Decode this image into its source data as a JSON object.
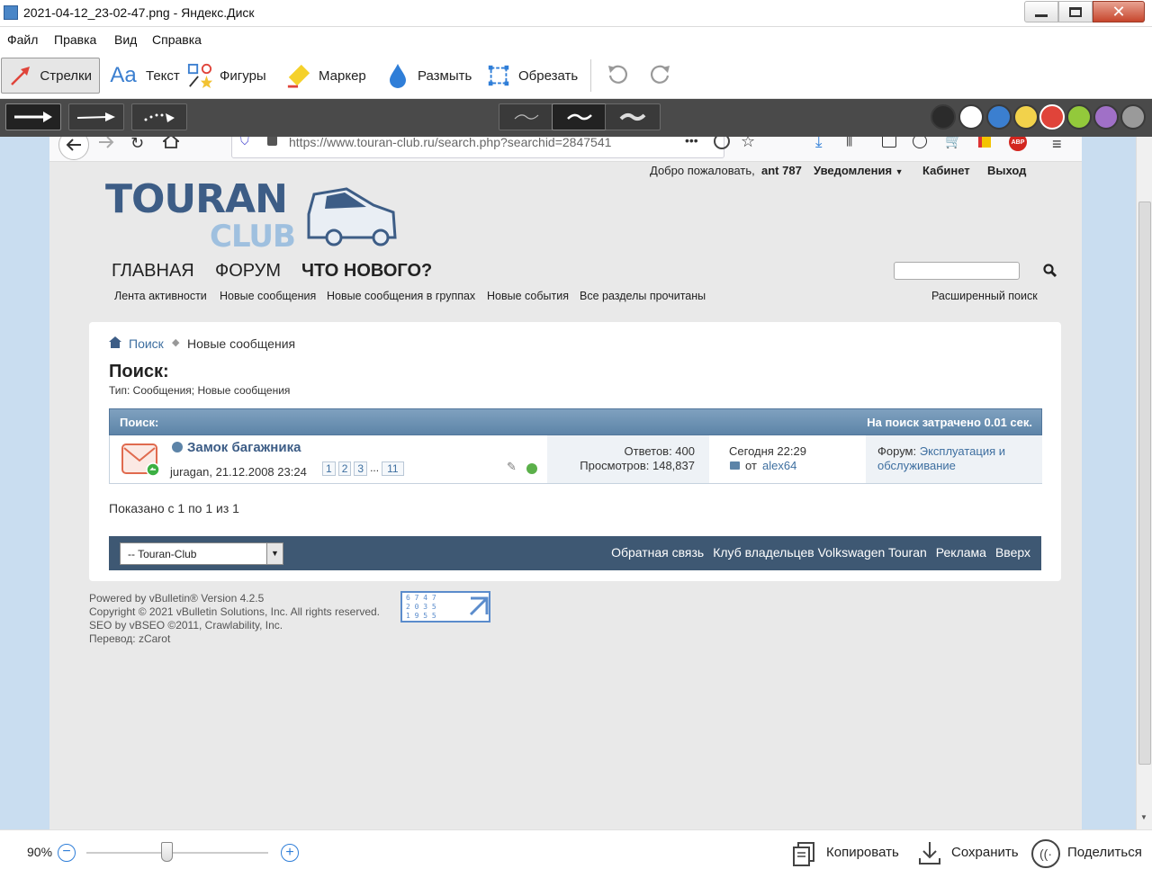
{
  "window": {
    "title": "2021-04-12_23-02-47.png - Яндекс.Диск",
    "close_glyph": "✕"
  },
  "menu": [
    "Файл",
    "Правка",
    "Вид",
    "Справка"
  ],
  "tools": [
    "Стрелки",
    "Текст",
    "Фигуры",
    "Маркер",
    "Размыть",
    "Обрезать"
  ],
  "palette": [
    "#2b2b2b",
    "#ffffff",
    "#3b7fd0",
    "#f2d24b",
    "#e0443a",
    "#93c93b",
    "#a070c7",
    "#9a9a9a"
  ],
  "browser": {
    "url": "https://www.touran-club.ru/search.php?searchid=2847541"
  },
  "forum": {
    "welcome": "Добро пожаловать,",
    "user": "ant 787",
    "notifications": "Уведомления",
    "cabinet": "Кабинет",
    "logout": "Выход",
    "logo_top": "TOURAN",
    "logo_bottom": "CLUB",
    "nav": [
      "ГЛАВНАЯ",
      "ФОРУМ",
      "ЧТО НОВОГО?"
    ],
    "subnav": [
      "Лента активности",
      "Новые сообщения",
      "Новые сообщения в группах",
      "Новые события",
      "Все разделы прочитаны"
    ],
    "advanced_search": "Расширенный поиск",
    "breadcrumb": {
      "link": "Поиск",
      "current": "Новые сообщения"
    },
    "page_title": "Поиск:",
    "page_subtitle": "Тип: Сообщения; Новые сообщения",
    "table_title": "Поиск:",
    "table_time": "На поиск затрачено 0.01 сек.",
    "thread": {
      "title": "Замок багажника",
      "starter": "juragan, 21.12.2008 23:24",
      "pages": [
        "1",
        "2",
        "3",
        "...",
        "11"
      ],
      "replies": "Ответов: 400",
      "views": "Просмотров: 148,837",
      "last_time": "Сегодня 22:29",
      "last_from": "от",
      "last_user": "alex64",
      "forum_label": "Форум:",
      "forum_link": "Эксплуатация и обслуживание"
    },
    "shown": "Показано с 1 по 1 из 1",
    "style_select": "-- Touran-Club",
    "footer_links": [
      "Обратная связь",
      "Клуб владельцев Volkswagen Touran",
      "Реклама",
      "Вверх"
    ],
    "credits": [
      "Powered by vBulletin® Version 4.2.5",
      "Copyright © 2021 vBulletin Solutions, Inc. All rights reserved.",
      "SEO by vBSEO ©2011, Crawlability, Inc.",
      "Перевод: zCarot"
    ],
    "counter": [
      "6 7 4 7",
      "2 0 3 5",
      "1 9 5 5"
    ]
  },
  "bottom": {
    "zoom": "90%",
    "copy": "Копировать",
    "save": "Сохранить",
    "share": "Поделиться"
  }
}
